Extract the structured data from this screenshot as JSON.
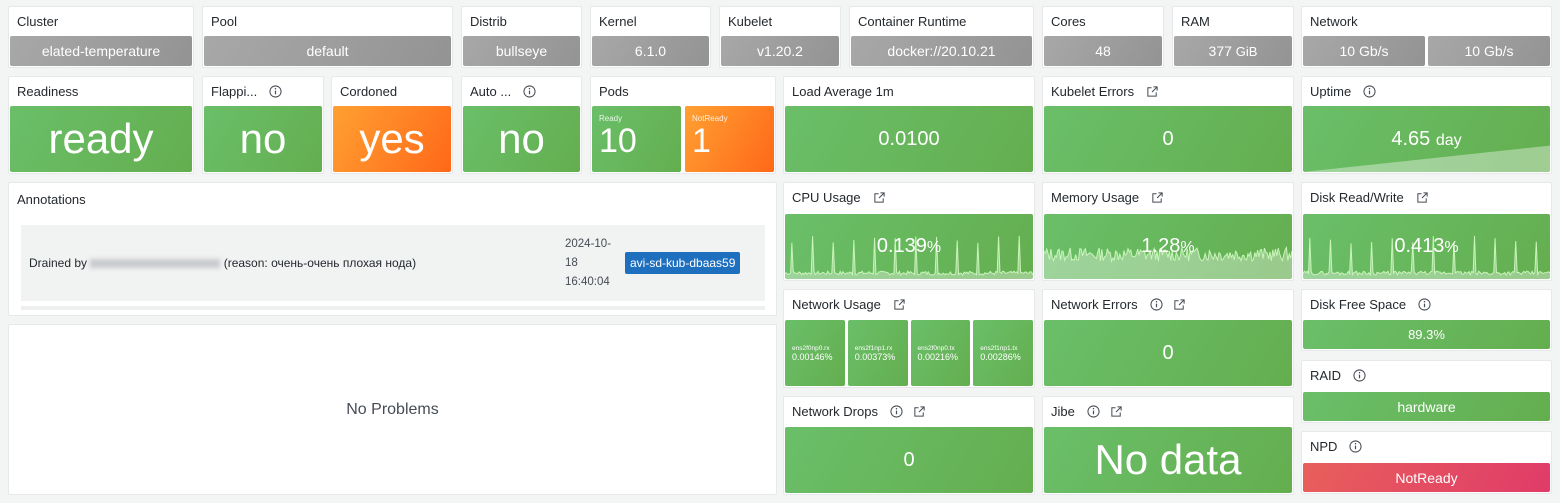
{
  "row1": {
    "cluster": {
      "title": "Cluster",
      "value": "elated-temperature"
    },
    "pool": {
      "title": "Pool",
      "value": "default"
    },
    "distrib": {
      "title": "Distrib",
      "value": "bullseye"
    },
    "kernel": {
      "title": "Kernel",
      "value": "6.1.0"
    },
    "kubelet": {
      "title": "Kubelet",
      "value": "v1.20.2"
    },
    "runtime": {
      "title": "Container Runtime",
      "value": "docker://20.10.21"
    },
    "cores": {
      "title": "Cores",
      "value": "48"
    },
    "ram": {
      "title": "RAM",
      "value": "377",
      "unit": "GiB"
    },
    "network": {
      "title": "Network",
      "values": [
        "10 Gb/s",
        "10 Gb/s"
      ]
    }
  },
  "row2": {
    "readiness": {
      "title": "Readiness",
      "value": "ready"
    },
    "flapping": {
      "title": "Flappi...",
      "value": "no"
    },
    "cordoned": {
      "title": "Cordoned",
      "value": "yes"
    },
    "auto": {
      "title": "Auto ...",
      "value": "no"
    },
    "pods": {
      "title": "Pods",
      "ready_label": "Ready",
      "ready_value": "10",
      "notready_label": "NotReady",
      "notready_value": "1"
    },
    "load": {
      "title": "Load Average 1m",
      "value": "0.0100"
    },
    "kubelet_errors": {
      "title": "Kubelet Errors",
      "value": "0"
    },
    "uptime": {
      "title": "Uptime",
      "value": "4.65",
      "unit": "day"
    }
  },
  "annotations": {
    "title": "Annotations",
    "items": [
      {
        "text_prefix": "Drained by",
        "text_suffix": "(reason: очень-очень плохая нода)",
        "date": "2024-10-18",
        "time": "16:40:04",
        "tag": "avi-sd-kub-dbaas59"
      }
    ]
  },
  "problems": {
    "text": "No Problems"
  },
  "cpu": {
    "title": "CPU Usage",
    "value": "0.139",
    "unit": "%"
  },
  "memory": {
    "title": "Memory Usage",
    "value": "1.28",
    "unit": "%"
  },
  "disk_rw": {
    "title": "Disk Read/Write",
    "value": "0.413",
    "unit": "%"
  },
  "net_usage": {
    "title": "Network Usage",
    "items": [
      {
        "label": "ens2f0np0.rx",
        "value": "0.00146%"
      },
      {
        "label": "ens2f1np1.rx",
        "value": "0.00373%"
      },
      {
        "label": "ens2f0np0.tx",
        "value": "0.00216%"
      },
      {
        "label": "ens2f1np1.tx",
        "value": "0.00286%"
      }
    ]
  },
  "net_errors": {
    "title": "Network Errors",
    "value": "0"
  },
  "disk_free": {
    "title": "Disk Free Space",
    "value": "89.3%"
  },
  "raid": {
    "title": "RAID",
    "value": "hardware"
  },
  "net_drops": {
    "title": "Network Drops",
    "value": "0"
  },
  "jibe": {
    "title": "Jibe",
    "value": "No data"
  },
  "npd": {
    "title": "NPD",
    "value": "NotReady"
  },
  "colors": {
    "green": "#64ae4f",
    "orange": "#ff7a1f",
    "red": "#e0446a",
    "gray": "#9d9d9d",
    "tag": "#1f6fbf"
  }
}
